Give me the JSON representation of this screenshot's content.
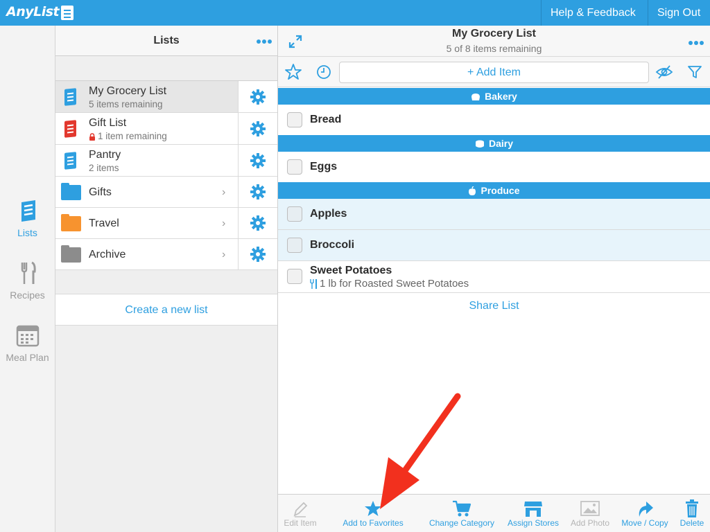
{
  "app": {
    "logo_text": "AnyList",
    "help_label": "Help & Feedback",
    "signout_label": "Sign Out"
  },
  "nav": [
    {
      "label": "Lists",
      "icon": "lists-icon",
      "active": true
    },
    {
      "label": "Recipes",
      "icon": "recipes-icon",
      "active": false
    },
    {
      "label": "Meal Plan",
      "icon": "meal-plan-icon",
      "active": false
    }
  ],
  "lists_panel": {
    "title": "Lists",
    "items": [
      {
        "name": "My Grocery List",
        "sub": "5 items remaining",
        "type": "list",
        "color": "#2e9fe0",
        "selected": true
      },
      {
        "name": "Gift List",
        "sub": "1 item remaining",
        "type": "list",
        "color": "#e2382e",
        "locked": true
      },
      {
        "name": "Pantry",
        "sub": "2 items",
        "type": "list",
        "color": "#2e9fe0"
      },
      {
        "name": "Gifts",
        "type": "folder",
        "color": "#2e9fe0"
      },
      {
        "name": "Travel",
        "type": "folder",
        "color": "#f7932f"
      },
      {
        "name": "Archive",
        "type": "folder",
        "color": "#8c8c8c"
      }
    ],
    "create_label": "Create a new list"
  },
  "main": {
    "title": "My Grocery List",
    "subtitle": "5 of 8 items remaining",
    "add_item_label": "+ Add Item",
    "categories": [
      {
        "name": "Bakery",
        "icon": "bakery-icon",
        "items": [
          {
            "name": "Bread"
          }
        ]
      },
      {
        "name": "Dairy",
        "icon": "dairy-icon",
        "items": [
          {
            "name": "Eggs"
          }
        ]
      },
      {
        "name": "Produce",
        "icon": "produce-icon",
        "items": [
          {
            "name": "Apples",
            "highlighted": true
          },
          {
            "name": "Broccoli",
            "highlighted": true
          },
          {
            "name": "Sweet Potatoes",
            "note": "1 lb for Roasted Sweet Potatoes"
          }
        ]
      }
    ],
    "share_label": "Share List"
  },
  "bottom_toolbar": [
    {
      "label": "Edit Item",
      "icon": "pencil-icon",
      "enabled": false
    },
    {
      "label": "Add to Favorites",
      "icon": "star-icon",
      "enabled": true
    },
    {
      "label": "Change Category",
      "icon": "cart-icon",
      "enabled": true
    },
    {
      "label": "Assign Stores",
      "icon": "store-icon",
      "enabled": true
    },
    {
      "label": "Add Photo",
      "icon": "photo-icon",
      "enabled": false
    },
    {
      "label": "Move / Copy",
      "icon": "move-icon",
      "enabled": true
    },
    {
      "label": "Delete",
      "icon": "trash-icon",
      "enabled": true
    }
  ],
  "colors": {
    "accent": "#2e9fe0",
    "annotation_arrow": "#f2301e"
  }
}
